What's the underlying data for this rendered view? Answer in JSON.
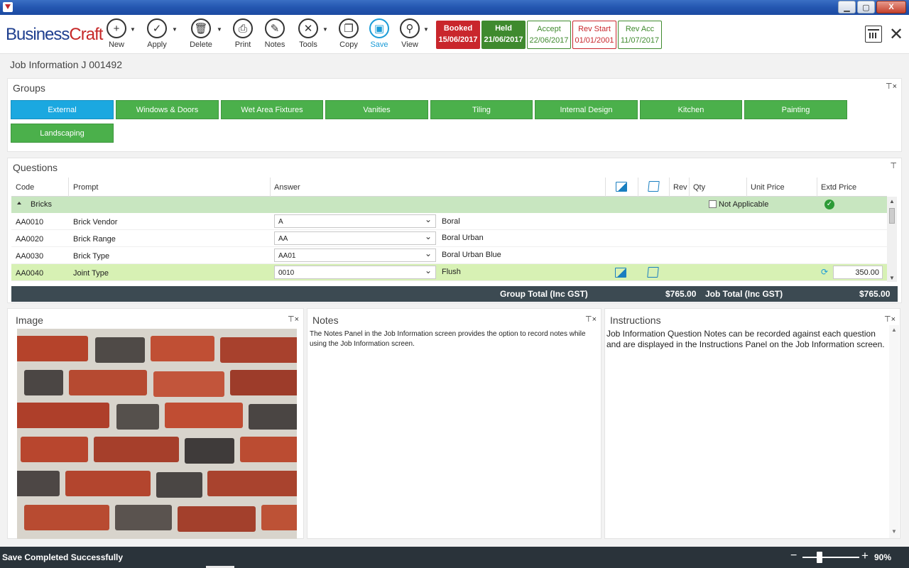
{
  "window": {
    "minimize": "▁",
    "maximize": "▢",
    "close": "X"
  },
  "app": {
    "logo_part1": "Business",
    "logo_part2": "Craft"
  },
  "toolbar": {
    "new": "New",
    "apply": "Apply",
    "delete": "Delete",
    "print": "Print",
    "notes": "Notes",
    "tools": "Tools",
    "copy": "Copy",
    "save": "Save",
    "view": "View"
  },
  "status_buttons": [
    {
      "label": "Booked",
      "date": "15/06/2017",
      "color": "#c9262c"
    },
    {
      "label": "Held",
      "date": "21/06/2017",
      "color": "#3f8a2e"
    },
    {
      "label": "Accept",
      "date": "22/06/2017",
      "color": "#3f8a2e"
    },
    {
      "label": "Rev Start",
      "date": "01/01/2001",
      "color": "#c9262c"
    },
    {
      "label": "Rev Acc",
      "date": "11/07/2017",
      "color": "#3f8a2e"
    }
  ],
  "page": {
    "subtitle": "Job Information J 001492"
  },
  "groups": {
    "title": "Groups",
    "pin": "⊤×",
    "items": [
      "External",
      "Windows & Doors",
      "Wet Area Fixtures",
      "Vanities",
      "Tiling",
      "Internal Design",
      "Kitchen",
      "Painting",
      "Landscaping"
    ],
    "active": "External",
    "active_color": "#1ba8e0",
    "item_color": "#4bb04b"
  },
  "questions": {
    "title": "Questions",
    "pin": "⊤",
    "headers": {
      "code": "Code",
      "prompt": "Prompt",
      "answer": "Answer",
      "rev": "Rev",
      "qty": "Qty",
      "unit_price": "Unit Price",
      "extd_price": "Extd Price"
    },
    "group_name": "Bricks",
    "not_applicable": "Not Applicable",
    "rows": [
      {
        "code": "AA0010",
        "prompt": "Brick Vendor",
        "answer": "A",
        "description": "Boral"
      },
      {
        "code": "AA0020",
        "prompt": "Brick Range",
        "answer": "AA",
        "description": "Boral Urban"
      },
      {
        "code": "AA0030",
        "prompt": "Brick Type",
        "answer": "AA01",
        "description": "Boral Urban Blue"
      },
      {
        "code": "AA0040",
        "prompt": "Joint Type",
        "answer": "0010",
        "description": "Flush",
        "extd_price": "350.00"
      }
    ],
    "totals": {
      "group_label": "Group Total (Inc GST)",
      "group_value": "$765.00",
      "job_label": "Job Total (Inc GST)",
      "job_value": "$765.00"
    }
  },
  "image_panel": {
    "title": "Image",
    "pin": "⊤×"
  },
  "notes_panel": {
    "title": "Notes",
    "pin": "⊤×",
    "text": "The Notes Panel in the Job Information screen provides the option to record notes while using the Job Information screen."
  },
  "instructions_panel": {
    "title": "Instructions",
    "pin": "⊤×",
    "text": "Job Information Question Notes can be recorded against each question and are displayed in the Instructions Panel on the Job Information screen."
  },
  "status_bar": {
    "message": "Save Completed Successfully",
    "zoom_minus": "−",
    "zoom_plus": "+",
    "zoom": "90%",
    "zoom_level_percent": 90
  }
}
